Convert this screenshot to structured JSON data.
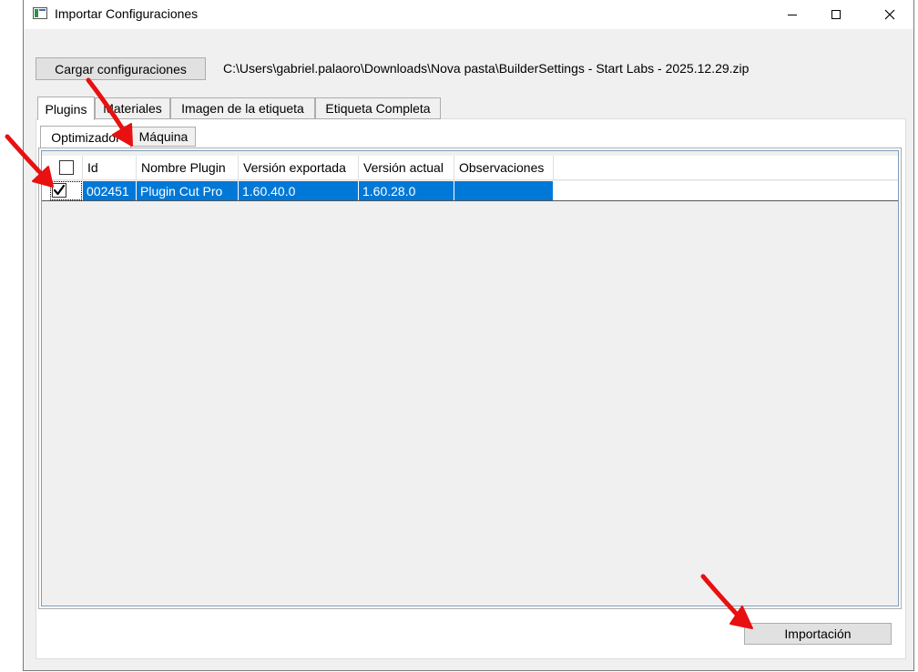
{
  "window": {
    "title": "Importar Configuraciones"
  },
  "toolbar": {
    "load_label": "Cargar configuraciones",
    "file_path": "C:\\Users\\gabriel.palaoro\\Downloads\\Nova pasta\\BuilderSettings - Start Labs - 2025.12.29.zip"
  },
  "tabs": [
    "Plugins",
    "Materiales",
    "Imagen de la etiqueta",
    "Etiqueta Completa"
  ],
  "subtabs": [
    "Optimizador",
    "Máquina"
  ],
  "grid": {
    "columns": [
      "Id",
      "Nombre Plugin",
      "Versión exportada",
      "Versión actual",
      "Observaciones"
    ],
    "rows": [
      {
        "checked": true,
        "id": "002451",
        "name": "Plugin Cut Pro",
        "exported": "1.60.40.0",
        "current": "1.60.28.0",
        "notes": ""
      }
    ]
  },
  "footer": {
    "import_label": "Importación"
  },
  "colors": {
    "selection": "#0078d7",
    "annotation_arrow": "#e81010"
  }
}
